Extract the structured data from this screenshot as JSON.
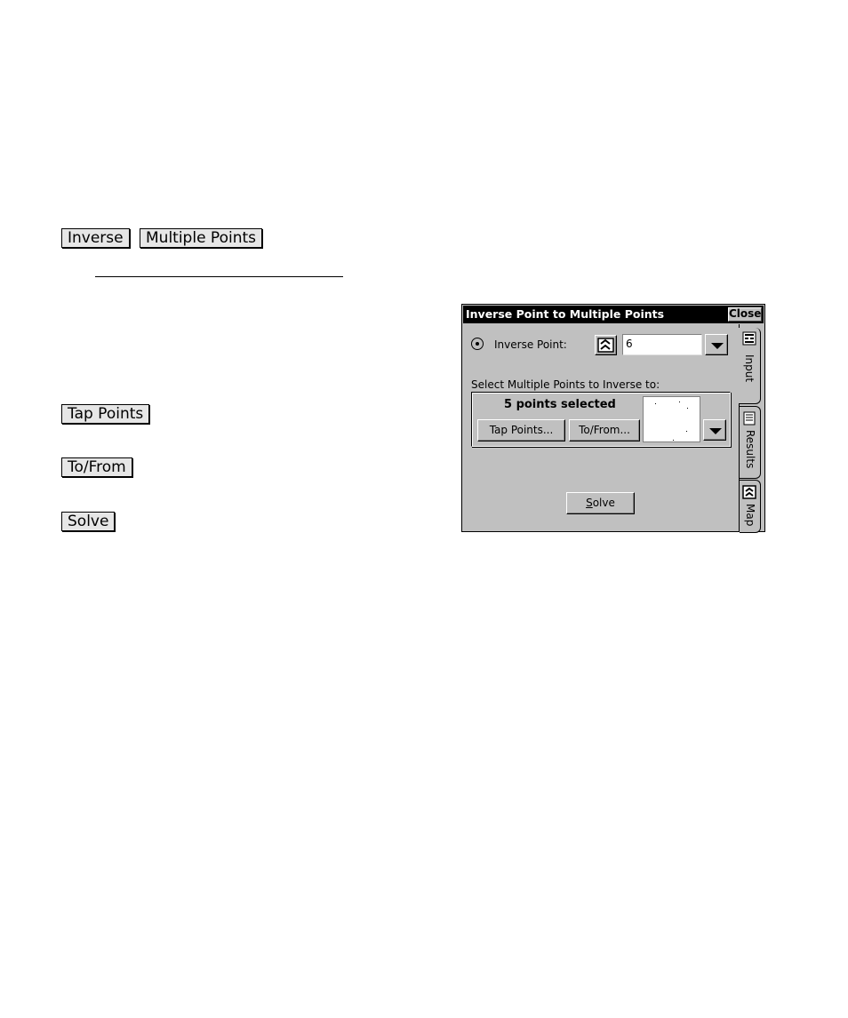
{
  "keys": {
    "inverse": "Inverse",
    "multiple_points": "Multiple Points",
    "tap_points": "Tap Points",
    "to_from": "To/From",
    "solve": "Solve"
  },
  "dialog": {
    "title": "Inverse Point to Multiple Points",
    "close_label": "Close",
    "inverse_point_label": "Inverse Point:",
    "inverse_point_value": "6",
    "select_label": "Select Multiple Points to Inverse to:",
    "selected_count_text": "5 points selected",
    "tap_points_button": "Tap Points...",
    "to_from_button": "To/From...",
    "solve_button_rest": "olve",
    "solve_button_mnemonic": "S",
    "tabs": [
      "Input",
      "Results",
      "Map"
    ]
  }
}
